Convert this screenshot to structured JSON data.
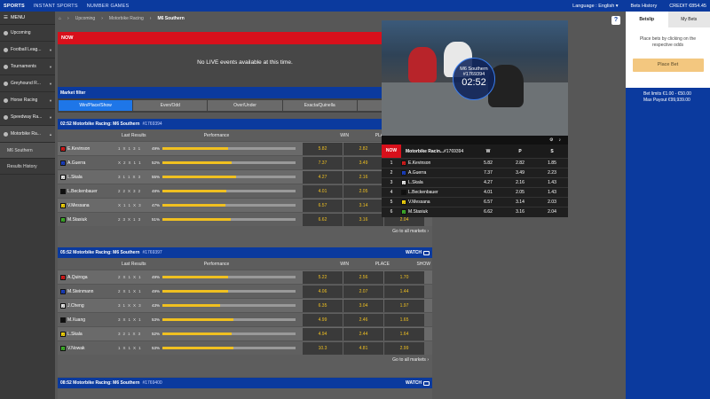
{
  "topbar": {
    "nav": [
      "SPORTS",
      "INSTANT SPORTS",
      "NUMBER GAMES"
    ],
    "language": "Language : English ▾",
    "bets_history": "Bets History",
    "credit": "CREDIT €854.45"
  },
  "sidebar": {
    "menu_label": "MENU",
    "items": [
      {
        "label": "Upcoming"
      },
      {
        "label": "Football Leag..."
      },
      {
        "label": "Tournaments"
      },
      {
        "label": "Greyhound R..."
      },
      {
        "label": "Horse Racing"
      },
      {
        "label": "Speedway Ra..."
      },
      {
        "label": "Motorbike Ra..."
      }
    ],
    "sub_items": [
      "M6 Southern",
      "Results History"
    ]
  },
  "breadcrumb": {
    "items": [
      "Upcoming",
      "Motorbike Racing"
    ],
    "current": "M6 Southern"
  },
  "now_section": {
    "label": "NOW",
    "message": "No LIVE events available at this time."
  },
  "market_filter": {
    "title": "Market filter",
    "tabs": [
      "Win/Place/Show",
      "Even/Odd",
      "Over/Under",
      "Exacta/Quinella",
      "Trifecta"
    ]
  },
  "columns": {
    "last_results": "Last Results",
    "performance": "Performance",
    "win": "WIN",
    "place": "PLACE",
    "show": "SHOW"
  },
  "goto_label": "Go to all markets ›",
  "races": [
    {
      "time_title": "02:52 Motorbike Racing: M6 Southern",
      "id": "#1769394",
      "status": "WAITING",
      "runners": [
        {
          "color": "#d41c1c",
          "mark": "/",
          "name": "E.Kevinson",
          "last": [
            "1",
            "X",
            "1",
            "3",
            "1"
          ],
          "perf_pct": 49,
          "perf_label": "49%",
          "win": "5.82",
          "place": "2.82",
          "show": "1.85"
        },
        {
          "color": "#1a3fbf",
          "mark": "/",
          "name": "A.Guerra",
          "last": [
            "X",
            "2",
            "X",
            "1",
            "1"
          ],
          "perf_pct": 52,
          "perf_label": "52%",
          "win": "7.37",
          "place": "3.49",
          "show": "2.23"
        },
        {
          "color": "#e6e6e6",
          "mark": "/",
          "name": "L.Skala",
          "last": [
            "3",
            "1",
            "1",
            "X",
            "3"
          ],
          "perf_pct": 55,
          "perf_label": "55%",
          "win": "4.27",
          "place": "2.16",
          "show": "1.43"
        },
        {
          "color": "#111111",
          "mark": "/",
          "name": "L.Beckenbauer",
          "last": [
            "2",
            "2",
            "X",
            "3",
            "2"
          ],
          "perf_pct": 48,
          "perf_label": "48%",
          "win": "4.01",
          "place": "2.05",
          "show": "1.43"
        },
        {
          "color": "#f2d20c",
          "mark": "/",
          "name": "V.Messana",
          "last": [
            "X",
            "1",
            "1",
            "X",
            "3"
          ],
          "perf_pct": 47,
          "perf_label": "47%",
          "win": "6.57",
          "place": "3.14",
          "show": "2.03"
        },
        {
          "color": "#3fae2a",
          "mark": "/",
          "name": "M.Stasiuk",
          "last": [
            "2",
            "3",
            "X",
            "1",
            "3"
          ],
          "perf_pct": 51,
          "perf_label": "51%",
          "win": "6.62",
          "place": "3.16",
          "show": "2.04"
        }
      ]
    },
    {
      "time_title": "05:52 Motorbike Racing: M6 Southern",
      "id": "#1769397",
      "status": "WATCH",
      "runners": [
        {
          "color": "#d41c1c",
          "mark": "/",
          "name": "A.Quiroga",
          "last": [
            "2",
            "X",
            "1",
            "X",
            "1"
          ],
          "perf_pct": 49,
          "perf_label": "49%",
          "win": "5.22",
          "place": "2.56",
          "show": "1.70"
        },
        {
          "color": "#1a3fbf",
          "mark": "/",
          "name": "M.Steinmann",
          "last": [
            "2",
            "X",
            "1",
            "X",
            "1"
          ],
          "perf_pct": 49,
          "perf_label": "49%",
          "win": "4.06",
          "place": "2.07",
          "show": "1.44"
        },
        {
          "color": "#e6e6e6",
          "mark": "/",
          "name": "J.Cheng",
          "last": [
            "3",
            "1",
            "X",
            "X",
            "3"
          ],
          "perf_pct": 43,
          "perf_label": "43%",
          "win": "6.35",
          "place": "3.04",
          "show": "1.97"
        },
        {
          "color": "#111111",
          "mark": "/",
          "name": "M.Xuang",
          "last": [
            "3",
            "X",
            "1",
            "X",
            "1"
          ],
          "perf_pct": 53,
          "perf_label": "53%",
          "win": "4.99",
          "place": "2.46",
          "show": "1.65"
        },
        {
          "color": "#f2d20c",
          "mark": "/",
          "name": "L.Skala",
          "last": [
            "3",
            "2",
            "1",
            "X",
            "3"
          ],
          "perf_pct": 52,
          "perf_label": "52%",
          "win": "4.94",
          "place": "2.44",
          "show": "1.64"
        },
        {
          "color": "#3fae2a",
          "mark": "/",
          "name": "V.Nowak",
          "last": [
            "1",
            "X",
            "1",
            "X",
            "1"
          ],
          "perf_pct": 53,
          "perf_label": "53%",
          "win": "10.3",
          "place": "4.81",
          "show": "2.99"
        }
      ]
    },
    {
      "time_title": "08:52 Motorbike Racing: M6 Southern",
      "id": "#1769400",
      "status": "WATCH",
      "runners": []
    }
  ],
  "video": {
    "track": "M6 Southern",
    "id": "#1769394",
    "countdown": "02:52"
  },
  "mini_table": {
    "now": "NOW",
    "title": "Motorbike Racin...",
    "id": "#1769394",
    "cols": [
      "W",
      "P",
      "S"
    ],
    "rows": [
      {
        "num": "1",
        "name": "E.Kevinson",
        "w": "5.82",
        "p": "2.82",
        "s": "1.85"
      },
      {
        "num": "2",
        "name": "A.Guerra",
        "w": "7.37",
        "p": "3.49",
        "s": "2.23"
      },
      {
        "num": "3",
        "name": "L.Skala",
        "w": "4.27",
        "p": "2.16",
        "s": "1.43"
      },
      {
        "num": "4",
        "name": "L.Beckenbauer",
        "w": "4.01",
        "p": "2.05",
        "s": "1.43"
      },
      {
        "num": "5",
        "name": "V.Messana",
        "w": "6.57",
        "p": "3.14",
        "s": "2.03"
      },
      {
        "num": "6",
        "name": "M.Stasiuk",
        "w": "6.62",
        "p": "3.16",
        "s": "2.04"
      }
    ]
  },
  "betslip": {
    "tabs": [
      "Betslip",
      "My Bets"
    ],
    "hint": "Place bets by clicking on the respective odds",
    "button": "Place Bet",
    "limits": "Bet limits €1.00 - €50.00",
    "max_payout": "Max Payout €99,939.00"
  }
}
